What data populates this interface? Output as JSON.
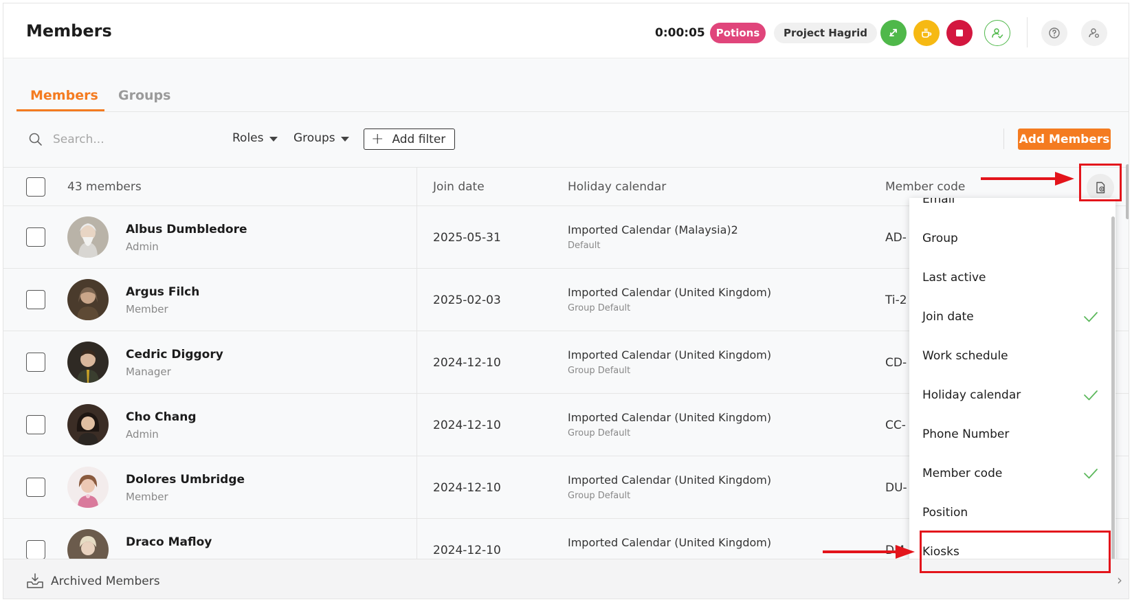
{
  "header": {
    "title": "Members",
    "timer": "0:00:05",
    "activity_pill": "Potions",
    "project_pill": "Project Hagrid"
  },
  "tabs": [
    {
      "label": "Members",
      "active": true
    },
    {
      "label": "Groups",
      "active": false
    }
  ],
  "toolbar": {
    "search_placeholder": "Search...",
    "roles_label": "Roles",
    "groups_label": "Groups",
    "add_filter_label": "Add filter",
    "add_members_label": "Add Members"
  },
  "table": {
    "count_label": "43 members",
    "headers": {
      "join_date": "Join date",
      "holiday_calendar": "Holiday calendar",
      "member_code": "Member code"
    },
    "rows": [
      {
        "name": "Albus Dumbledore",
        "role": "Admin",
        "join_date": "2025-05-31",
        "calendar": "Imported Calendar (Malaysia)2",
        "calendar_sub": "Default",
        "code": "AD-"
      },
      {
        "name": "Argus Filch",
        "role": "Member",
        "join_date": "2025-02-03",
        "calendar": "Imported Calendar (United Kingdom)",
        "calendar_sub": "Group Default",
        "code": "Ti-2"
      },
      {
        "name": "Cedric Diggory",
        "role": "Manager",
        "join_date": "2024-12-10",
        "calendar": "Imported Calendar (United Kingdom)",
        "calendar_sub": "Group Default",
        "code": "CD-"
      },
      {
        "name": "Cho Chang",
        "role": "Admin",
        "join_date": "2024-12-10",
        "calendar": "Imported Calendar (United Kingdom)",
        "calendar_sub": "Group Default",
        "code": "CC-"
      },
      {
        "name": "Dolores Umbridge",
        "role": "Member",
        "join_date": "2024-12-10",
        "calendar": "Imported Calendar (United Kingdom)",
        "calendar_sub": "Group Default",
        "code": "DU-"
      },
      {
        "name": "Draco Mafloy",
        "role": "",
        "join_date": "2024-12-10",
        "calendar": "Imported Calendar (United Kingdom)",
        "calendar_sub": "",
        "code": "DM"
      }
    ]
  },
  "column_menu": {
    "items": [
      {
        "label": "Email",
        "checked": false
      },
      {
        "label": "Group",
        "checked": false
      },
      {
        "label": "Last active",
        "checked": false
      },
      {
        "label": "Join date",
        "checked": true
      },
      {
        "label": "Work schedule",
        "checked": false
      },
      {
        "label": "Holiday calendar",
        "checked": true
      },
      {
        "label": "Phone Number",
        "checked": false
      },
      {
        "label": "Member code",
        "checked": true
      },
      {
        "label": "Position",
        "checked": false
      },
      {
        "label": "Kiosks",
        "checked": false
      }
    ]
  },
  "footer": {
    "archived_label": "Archived Members"
  },
  "colors": {
    "accent": "#f47b20",
    "activity_pill": "#e0457b",
    "green": "#4fb84a",
    "yellow": "#f6b913",
    "red": "#d3173f",
    "annotation": "#e3141b"
  }
}
